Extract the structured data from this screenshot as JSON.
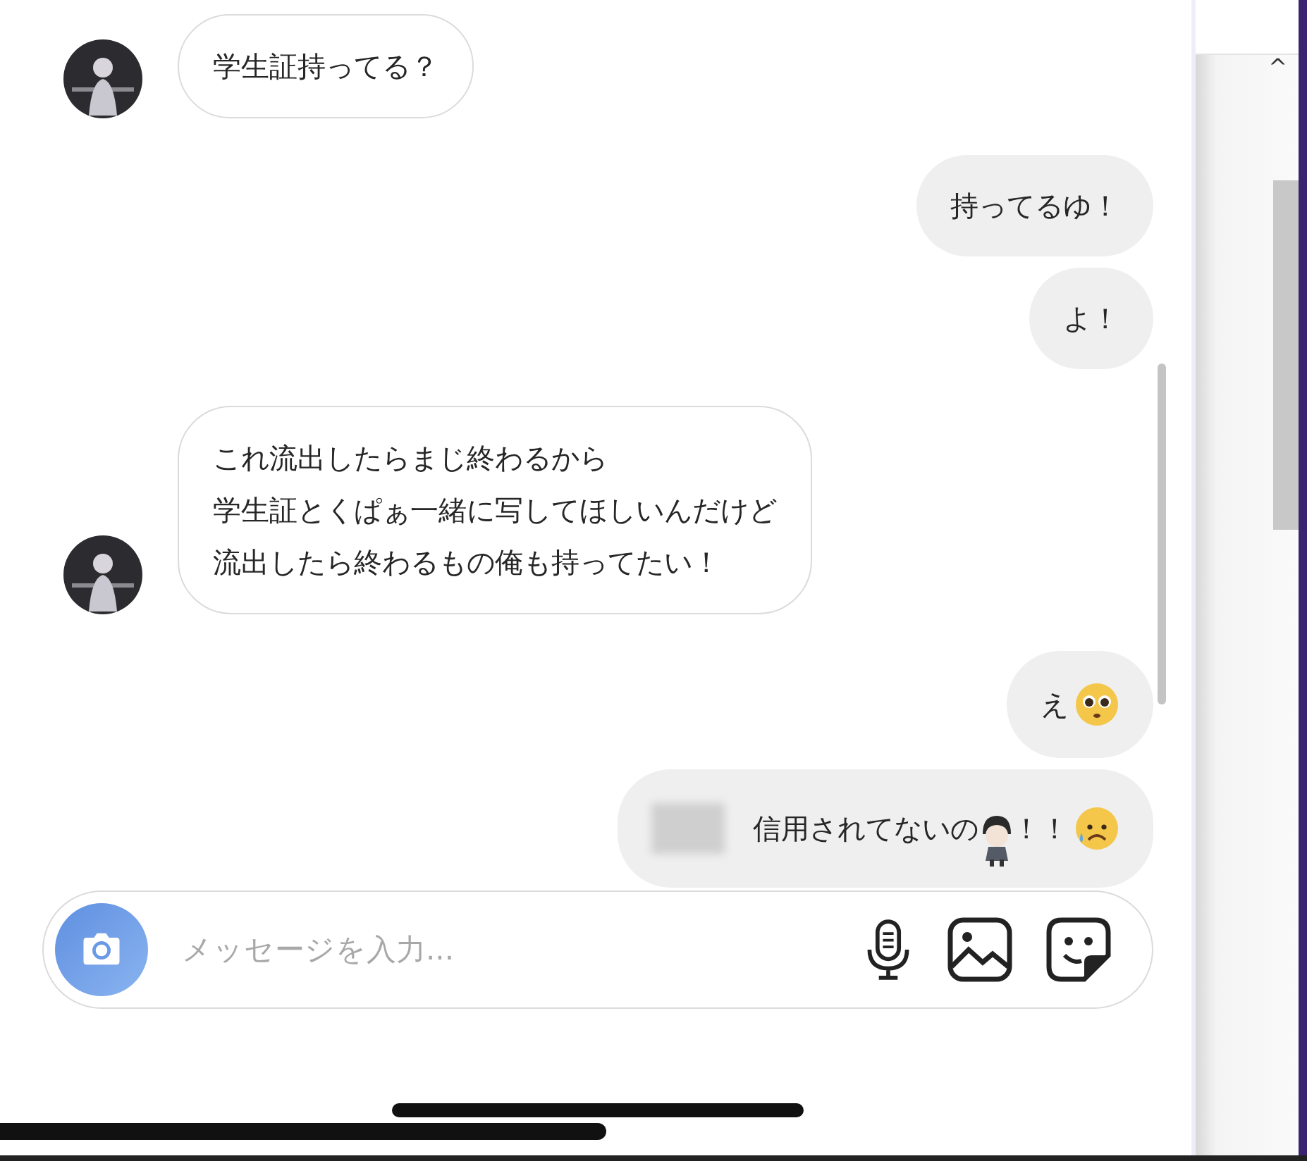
{
  "messages": [
    {
      "kind": "received",
      "lines": [
        "学生証持ってる？"
      ]
    },
    {
      "kind": "sent",
      "lines": [
        "持ってるゆ！"
      ]
    },
    {
      "kind": "sent",
      "lines": [
        "よ！"
      ]
    },
    {
      "kind": "received",
      "lines": [
        "これ流出したらまじ終わるから",
        "学生証とくぱぁ一緒に写してほしいんだけど",
        "流出したら終わるもの俺も持ってたい！"
      ]
    },
    {
      "kind": "sent",
      "lines": [
        "え"
      ],
      "emoji": {
        "kind": "pleading"
      }
    },
    {
      "kind": "sent",
      "lines": [
        "信用されてないの",
        "！！"
      ],
      "redacted": true,
      "sticker": true,
      "emoji": {
        "kind": "sad"
      }
    }
  ],
  "composer": {
    "placeholder": "メッセージを入力..."
  },
  "scroll_panel": {
    "arrow": "^"
  }
}
